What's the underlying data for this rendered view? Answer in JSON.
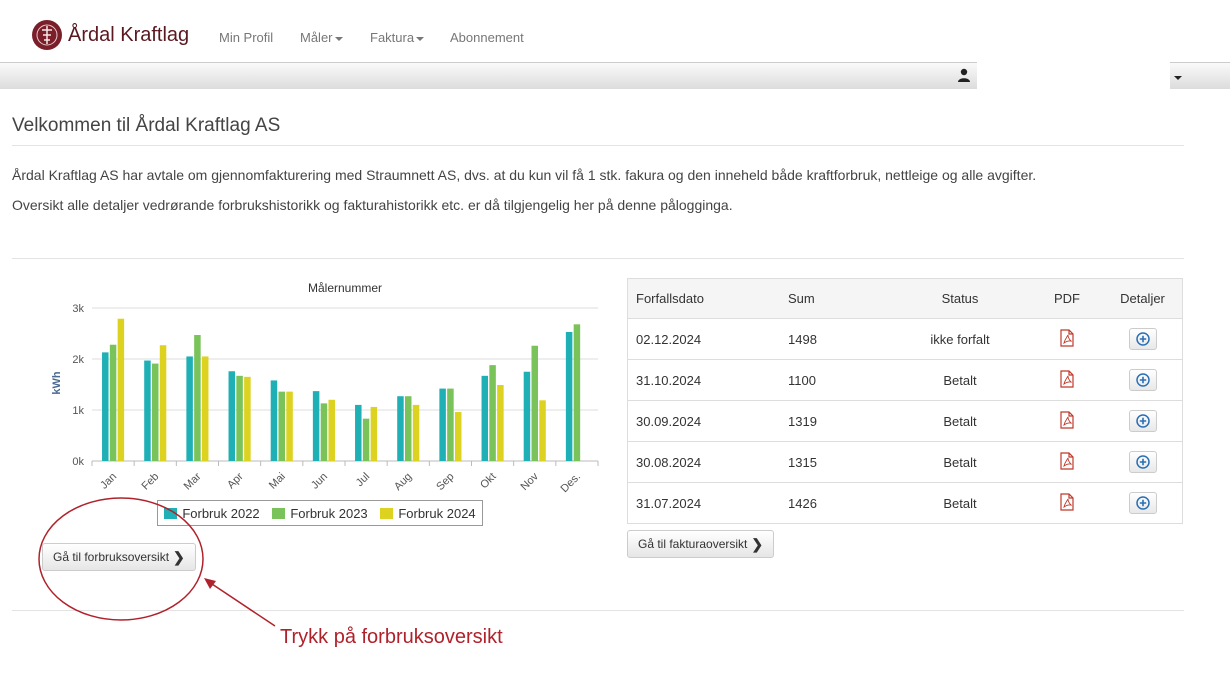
{
  "brand": {
    "name": "Årdal Kraftlag",
    "color": "#7a1f2a"
  },
  "nav": {
    "items": [
      {
        "label": "Min Profil",
        "dropdown": false
      },
      {
        "label": "Måler",
        "dropdown": true
      },
      {
        "label": "Faktura",
        "dropdown": true
      },
      {
        "label": "Abonnement",
        "dropdown": false
      }
    ]
  },
  "toolbar": {
    "icons": [
      "user-icon",
      "chevron-down-icon"
    ]
  },
  "page": {
    "title": "Velkommen til Årdal Kraftlag AS",
    "intro1": "Årdal Kraftlag AS har avtale om gjennomfakturering med Straumnett AS, dvs. at du kun vil få 1 stk. fakura og den inneheld både kraftforbruk, nettleige og alle avgifter.",
    "intro2": "Oversikt alle detaljer vedrørande forbrukshistorikk og fakturahistorikk etc. er då tilgjengelig her på denne pålogginga."
  },
  "chart_data": {
    "type": "bar",
    "title": "Målernummer",
    "ylabel": "kWh",
    "xlabel": "",
    "ylim": [
      0,
      3000
    ],
    "yticks": [
      0,
      1000,
      2000,
      3000
    ],
    "ytick_labels": [
      "0k",
      "1k",
      "2k",
      "3k"
    ],
    "grid": true,
    "legend": "bottom",
    "categories": [
      "Jan",
      "Feb",
      "Mar",
      "Apr",
      "Mai",
      "Jun",
      "Jul",
      "Aug",
      "Sep",
      "Okt",
      "Nov",
      "Des."
    ],
    "series": [
      {
        "name": "Forbruk 2022",
        "color": "#1fb0b6",
        "values": [
          2130,
          1970,
          2050,
          1760,
          1580,
          1370,
          1100,
          1270,
          1420,
          1670,
          1750,
          2530
        ]
      },
      {
        "name": "Forbruk 2023",
        "color": "#79c35a",
        "values": [
          2280,
          1910,
          2470,
          1670,
          1360,
          1130,
          830,
          1270,
          1420,
          1880,
          2260,
          2680
        ]
      },
      {
        "name": "Forbruk 2024",
        "color": "#dcd21f",
        "values": [
          2790,
          2270,
          2050,
          1650,
          1360,
          1200,
          1060,
          1100,
          960,
          1490,
          1190,
          null
        ]
      }
    ]
  },
  "buttons": {
    "consumption": "Gå til forbruksoversikt",
    "invoices": "Gå til fakturaoversikt"
  },
  "invoices": {
    "headers": [
      "Forfallsdato",
      "Sum",
      "Status",
      "PDF",
      "Detaljer"
    ],
    "rows": [
      {
        "date": "02.12.2024",
        "sum": "1498",
        "status": "ikke forfalt"
      },
      {
        "date": "31.10.2024",
        "sum": "1100",
        "status": "Betalt"
      },
      {
        "date": "30.09.2024",
        "sum": "1319",
        "status": "Betalt"
      },
      {
        "date": "30.08.2024",
        "sum": "1315",
        "status": "Betalt"
      },
      {
        "date": "31.07.2024",
        "sum": "1426",
        "status": "Betalt"
      }
    ]
  },
  "annotation": {
    "text": "Trykk på forbruksoversikt",
    "color": "#b0222b"
  }
}
